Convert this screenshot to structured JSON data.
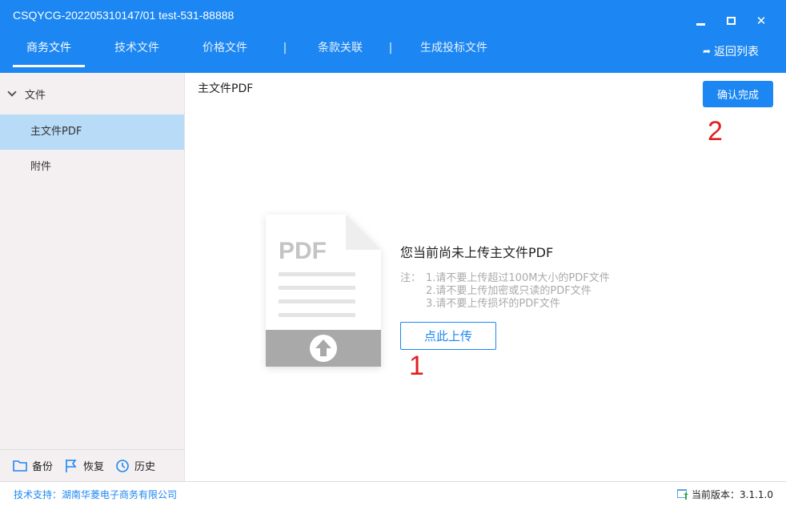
{
  "window": {
    "title": "CSQYCG-202205310147/01 test-531-88888",
    "minimize_icon": "minimize-icon",
    "maximize_icon": "maximize-icon",
    "close_icon": "close-icon",
    "close_glyph": "✕"
  },
  "tabs": [
    {
      "label": "商务文件",
      "active": true
    },
    {
      "label": "技术文件",
      "active": false
    },
    {
      "label": "价格文件",
      "active": false
    },
    {
      "label": "条款关联",
      "active": false
    },
    {
      "label": "生成投标文件",
      "active": false
    }
  ],
  "tab_separator": "|",
  "back": {
    "arrow": "➦",
    "label": "返回列表"
  },
  "sidebar": {
    "root_label": "文件",
    "items": [
      {
        "label": "主文件PDF",
        "selected": true
      },
      {
        "label": "附件",
        "selected": false
      }
    ],
    "footer": [
      {
        "label": "备份",
        "icon": "folder-icon"
      },
      {
        "label": "恢复",
        "icon": "flag-icon"
      },
      {
        "label": "历史",
        "icon": "history-icon"
      }
    ]
  },
  "content": {
    "title": "主文件PDF",
    "confirm_label": "确认完成",
    "pdf_label": "PDF",
    "upload_title": "您当前尚未上传主文件PDF",
    "notes_prefix": "注：",
    "notes": [
      "1.请不要上传超过100M大小的PDF文件",
      "2.请不要上传加密或只读的PDF文件",
      "3.请不要上传损坏的PDF文件"
    ],
    "upload_label": "点此上传",
    "mark_1": "1",
    "mark_2": "2"
  },
  "status": {
    "support": "技术支持：湖南华菱电子商务有限公司",
    "version": "当前版本：3.1.1.0"
  },
  "colors": {
    "primary": "#1c86f2",
    "sidebar_bg": "#f4f0f2",
    "selected_bg": "#b8dcf8",
    "annotation": "#e02020"
  }
}
